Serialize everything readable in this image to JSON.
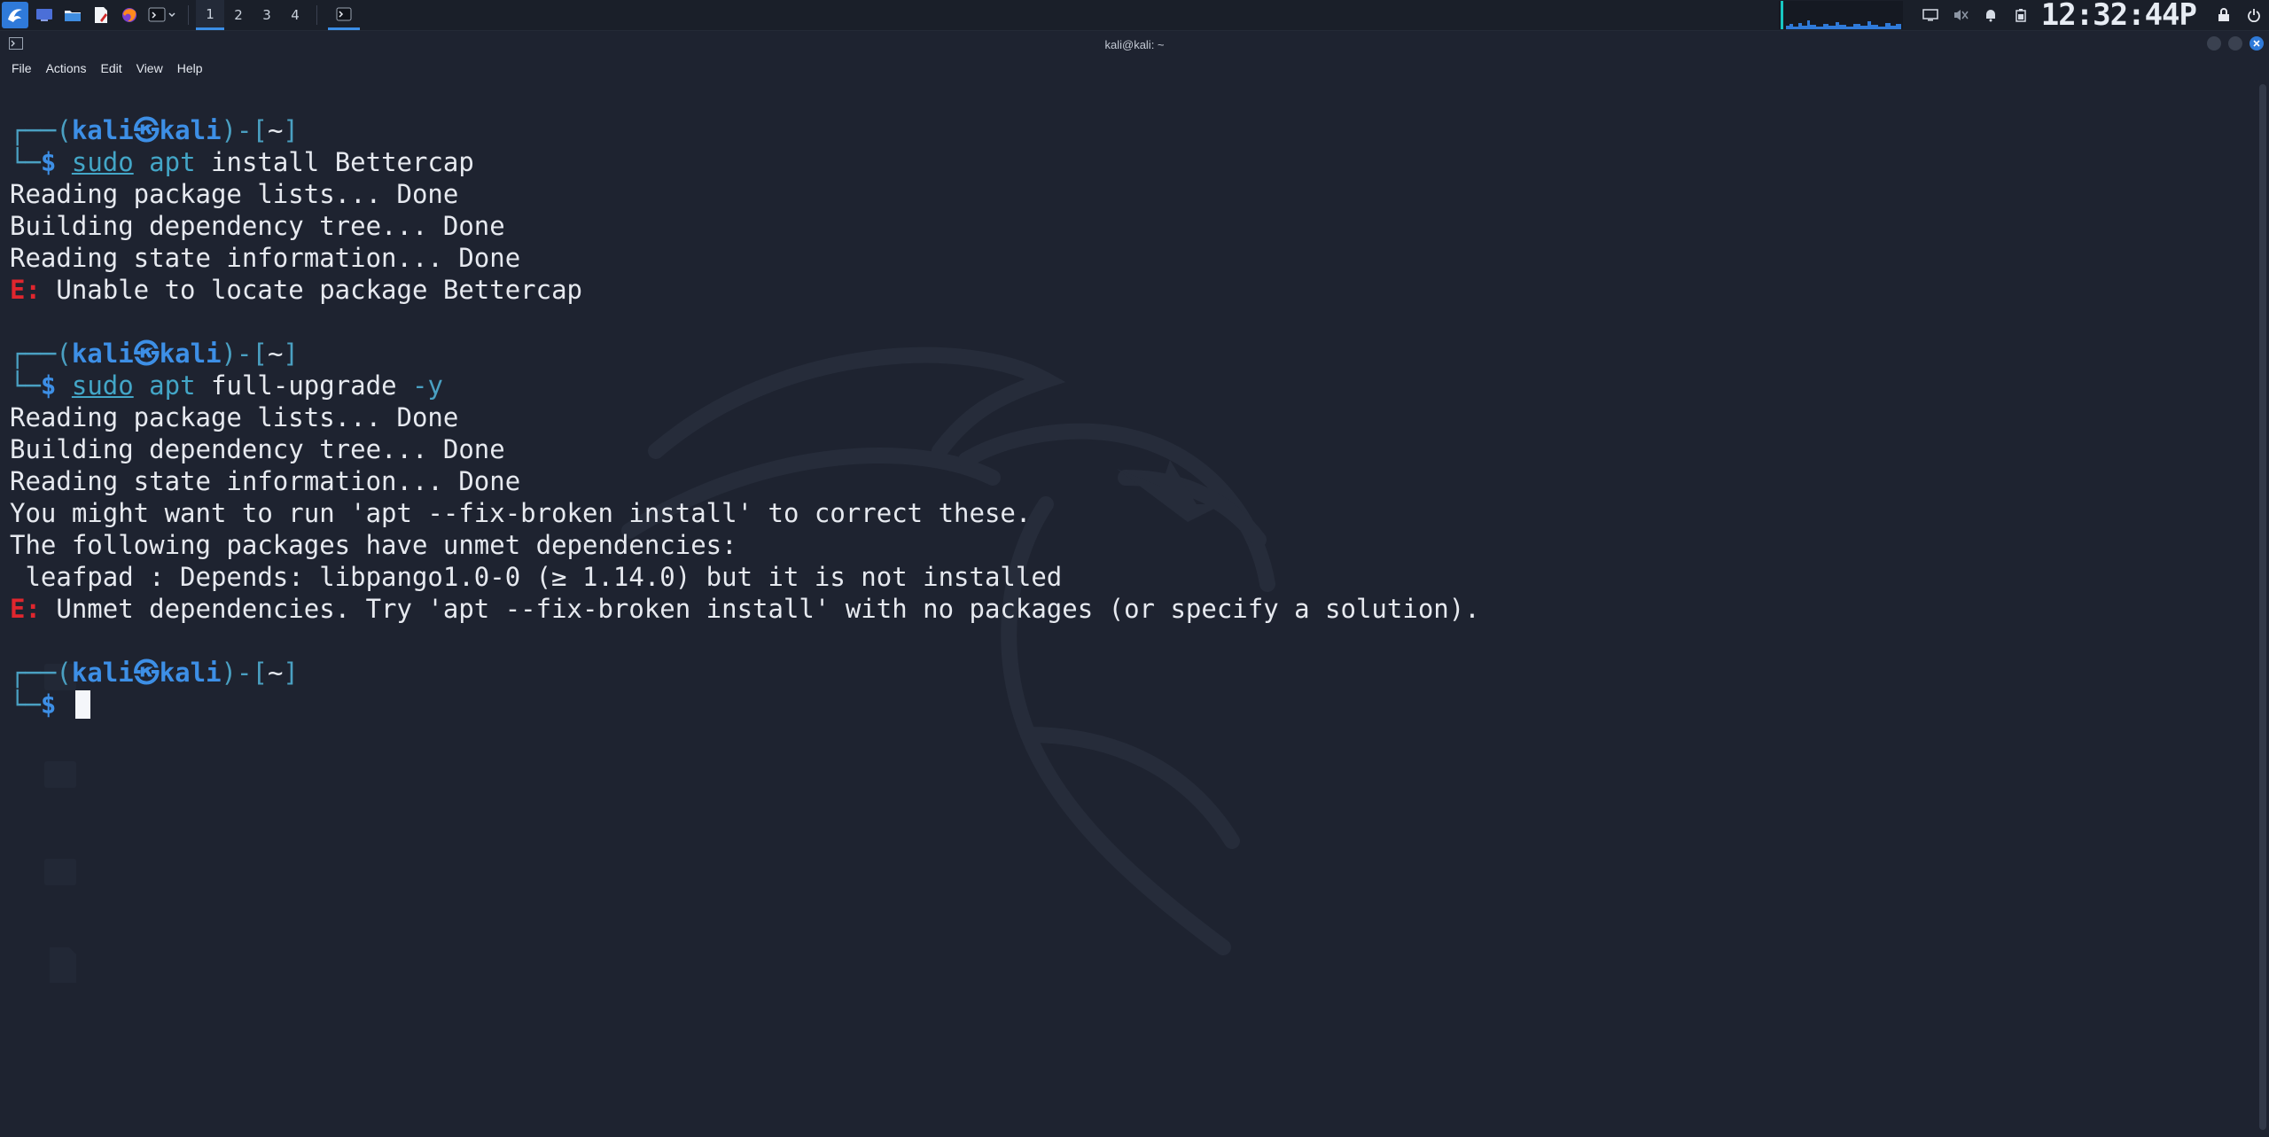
{
  "panel": {
    "workspaces": [
      "1",
      "2",
      "3",
      "4"
    ],
    "active_workspace": 0,
    "clock": "12:32:44P",
    "icons": {
      "menu": "kali-menu-icon",
      "launchers": [
        "desktop-icon",
        "file-manager-icon",
        "text-editor-icon",
        "firefox-icon",
        "terminal-icon"
      ],
      "tray": [
        "display-icon",
        "mute-icon",
        "notification-icon",
        "battery-icon",
        "lock-icon",
        "power-icon"
      ]
    }
  },
  "window": {
    "title": "kali@kali: ~",
    "menus": [
      "File",
      "Actions",
      "Edit",
      "View",
      "Help"
    ]
  },
  "terminal": {
    "prompt": {
      "box_top": "┌──(",
      "user": "kali",
      "at": "㉿",
      "host": "kali",
      "box_mid": ")-[",
      "dir": "~",
      "box_end": "]",
      "box_bottom": "└─",
      "dollar": "$"
    },
    "blocks": [
      {
        "cmd": "sudo",
        "cmd2": "apt",
        "args": "install Bettercap",
        "opt": "",
        "output": [
          {
            "type": "out",
            "text": "Reading package lists... Done"
          },
          {
            "type": "out",
            "text": "Building dependency tree... Done"
          },
          {
            "type": "out",
            "text": "Reading state information... Done"
          },
          {
            "type": "err",
            "label": "E:",
            "text": " Unable to locate package Bettercap"
          }
        ]
      },
      {
        "cmd": "sudo",
        "cmd2": "apt",
        "args": "full-upgrade ",
        "opt": "-y",
        "output": [
          {
            "type": "out",
            "text": "Reading package lists... Done"
          },
          {
            "type": "out",
            "text": "Building dependency tree... Done"
          },
          {
            "type": "out",
            "text": "Reading state information... Done"
          },
          {
            "type": "out",
            "text": "You might want to run 'apt --fix-broken install' to correct these."
          },
          {
            "type": "out",
            "text": "The following packages have unmet dependencies:"
          },
          {
            "type": "out",
            "text": " leafpad : Depends: libpango1.0-0 (≥ 1.14.0) but it is not installed"
          },
          {
            "type": "err",
            "label": "E:",
            "text": " Unmet dependencies. Try 'apt --fix-broken install' with no packages (or specify a solution)."
          }
        ]
      }
    ]
  },
  "colors": {
    "background": "#1e2330",
    "accent": "#3d8fe6",
    "error": "#e0262e"
  }
}
